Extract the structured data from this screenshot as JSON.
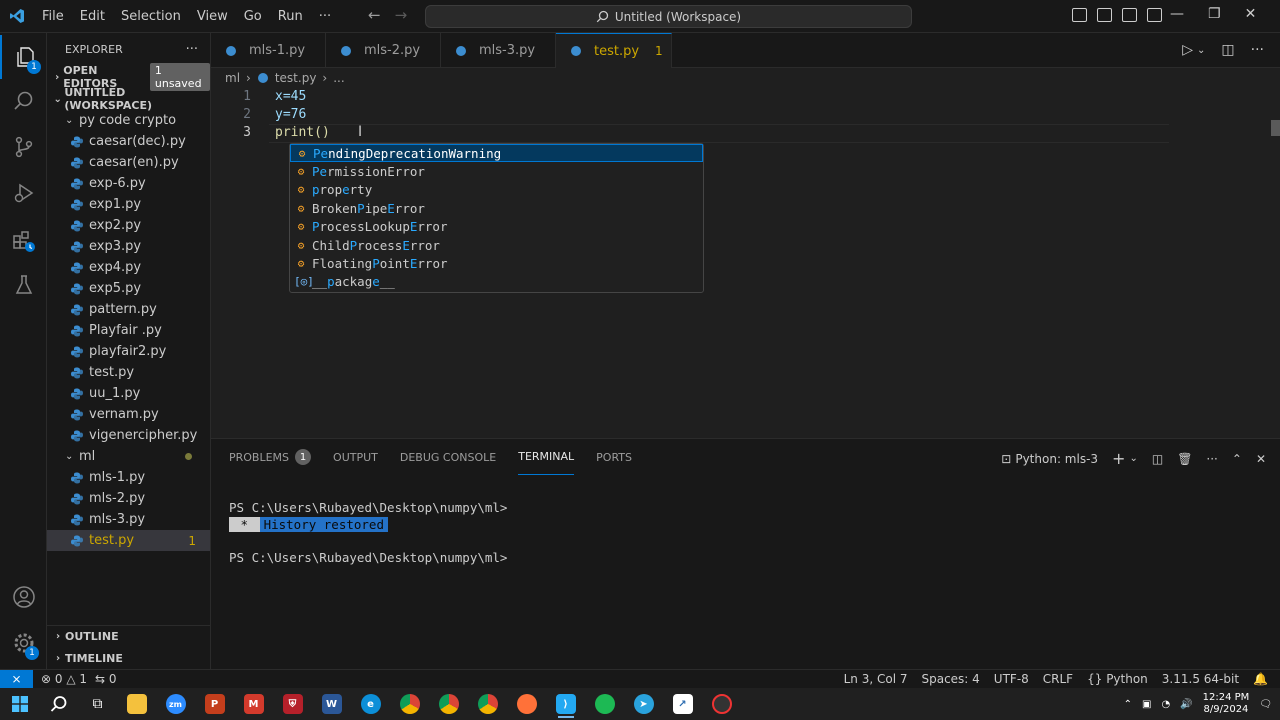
{
  "titlebar": {
    "menu": [
      "File",
      "Edit",
      "Selection",
      "View",
      "Go",
      "Run",
      "···"
    ],
    "search_text": "Untitled (Workspace)"
  },
  "activity": {
    "explorer_badge": "1",
    "settings_badge": "1"
  },
  "sidebar": {
    "title": "EXPLORER",
    "more": "···",
    "open_editors": "OPEN EDITORS",
    "unsaved_badge": "1 unsaved",
    "workspace": "UNTITLED (WORKSPACE)",
    "folder1": "py code crypto",
    "folder1_files": [
      "caesar(dec).py",
      "caesar(en).py",
      "exp-6.py",
      "exp1.py",
      "exp2.py",
      "exp3.py",
      "exp4.py",
      "exp5.py",
      "pattern.py",
      "Playfair .py",
      "playfair2.py",
      "test.py",
      "uu_1.py",
      "vernam.py",
      "vigenercipher.py"
    ],
    "folder2": "ml",
    "folder2_files": [
      "mls-1.py",
      "mls-2.py",
      "mls-3.py"
    ],
    "selected_file": "test.py",
    "selected_badge": "1",
    "outline": "OUTLINE",
    "timeline": "TIMELINE"
  },
  "tabs": [
    {
      "label": "mls-1.py"
    },
    {
      "label": "mls-2.py"
    },
    {
      "label": "mls-3.py"
    },
    {
      "label": "test.py",
      "count": "1"
    }
  ],
  "breadcrumb": {
    "folder": "ml",
    "file": "test.py",
    "more": "..."
  },
  "editor": {
    "line_numbers": [
      "1",
      "2",
      "3"
    ],
    "lines": [
      "x=45",
      "y=76",
      "print()"
    ]
  },
  "suggestions": [
    {
      "pre": "",
      "hl": "Pe",
      "post": "ndingDeprecationWarning",
      "kind": "class"
    },
    {
      "pre": "",
      "hl": "Pe",
      "post": "rmissionError",
      "kind": "class"
    },
    {
      "pre": "",
      "hl": "p",
      "post": "rop",
      "hl2": "e",
      "post2": "rty",
      "kind": "class"
    },
    {
      "pre": "Broken",
      "hl": "P",
      "post": "ipe",
      "hl2": "E",
      "post2": "rror",
      "kind": "class"
    },
    {
      "pre": "",
      "hl": "P",
      "post": "rocessLookup",
      "hl2": "E",
      "post2": "rror",
      "kind": "class"
    },
    {
      "pre": "Child",
      "hl": "P",
      "post": "rocess",
      "hl2": "E",
      "post2": "rror",
      "kind": "class"
    },
    {
      "pre": "Floating",
      "hl": "P",
      "post": "oint",
      "hl2": "E",
      "post2": "rror",
      "kind": "class"
    },
    {
      "pre": "__",
      "hl": "p",
      "post": "ackag",
      "hl2": "e",
      "post2": "__",
      "kind": "field"
    }
  ],
  "panel": {
    "tabs": [
      "PROBLEMS",
      "OUTPUT",
      "DEBUG CONSOLE",
      "TERMINAL",
      "PORTS"
    ],
    "problems_count": "1",
    "active_tab": "TERMINAL",
    "terminal_name": "Python: mls-3",
    "prompt1": "PS C:\\Users\\Rubayed\\Desktop\\numpy\\ml>",
    "history_star": " * ",
    "history": "History restored",
    "prompt2": "PS C:\\Users\\Rubayed\\Desktop\\numpy\\ml>"
  },
  "statusbar": {
    "errors": "0",
    "warnings": "1",
    "ports": "0",
    "position": "Ln 3, Col 7",
    "spaces": "Spaces: 4",
    "encoding": "UTF-8",
    "eol": "CRLF",
    "language": "Python",
    "interpreter": "3.11.5 64-bit"
  },
  "taskbar": {
    "time": "12:24 PM",
    "date": "8/9/2024",
    "zoom_label": "zm"
  },
  "colors": {
    "accent": "#0078d4",
    "modified": "#cca700"
  }
}
